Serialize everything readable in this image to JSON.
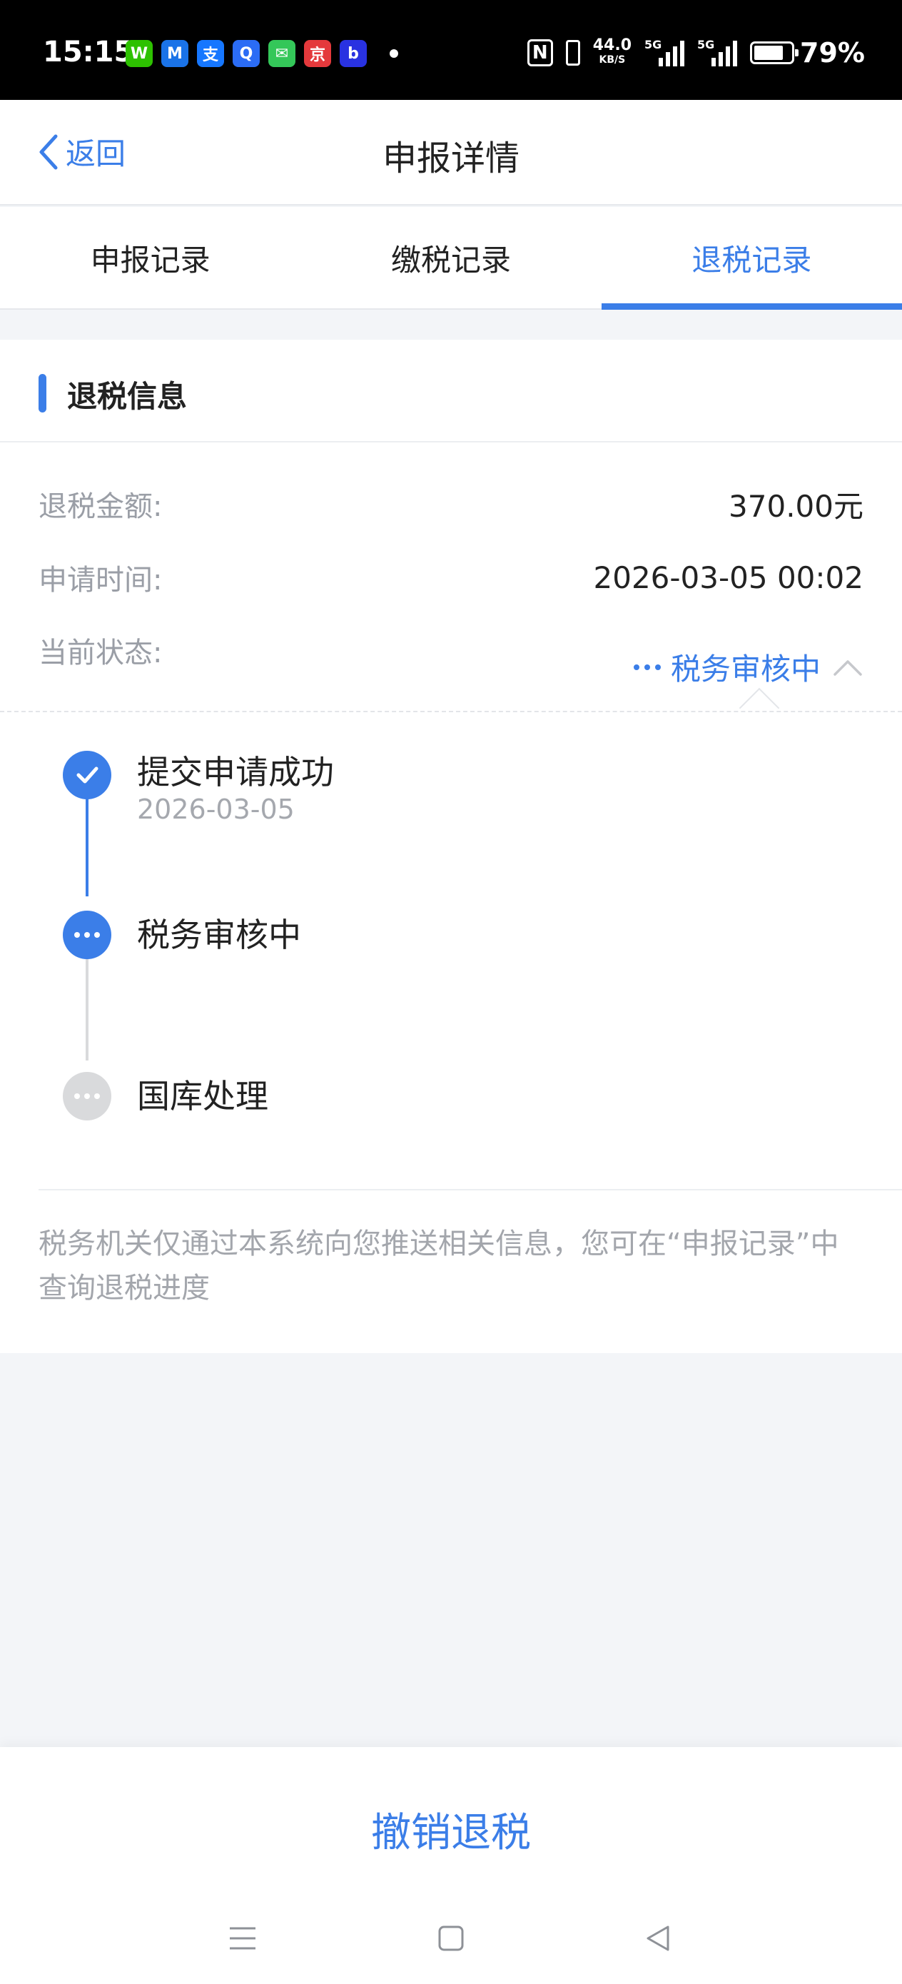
{
  "status_bar": {
    "time": "15:15",
    "apps": [
      {
        "name": "wechat-icon",
        "color": "#2dc100",
        "glyph": "W"
      },
      {
        "name": "mail-icon",
        "color": "#1a73e8",
        "glyph": "M"
      },
      {
        "name": "alipay-icon",
        "color": "#1677ff",
        "glyph": "支"
      },
      {
        "name": "qq-icon",
        "color": "#2b6cf5",
        "glyph": "Q"
      },
      {
        "name": "messages-icon",
        "color": "#34c759",
        "glyph": "✉"
      },
      {
        "name": "jd-icon",
        "color": "#e4393c",
        "glyph": "京"
      },
      {
        "name": "baidu-icon",
        "color": "#2932e1",
        "glyph": "b"
      }
    ],
    "net_speed": "44.0",
    "net_unit": "KB/S",
    "sig1_label": "5G",
    "sig2_label": "5G",
    "battery": "79%",
    "battery_level": 0.79
  },
  "header": {
    "back_label": "返回",
    "title": "申报详情"
  },
  "tabs": [
    {
      "label": "申报记录",
      "active": false
    },
    {
      "label": "缴税记录",
      "active": false
    },
    {
      "label": "退税记录",
      "active": true
    }
  ],
  "refund": {
    "section_title": "退税信息",
    "amount_label": "退税金额:",
    "amount_value": "370.00元",
    "time_label": "申请时间:",
    "time_value": "2026-03-05 00:02",
    "status_label": "当前状态:",
    "status_value": "税务审核中"
  },
  "timeline": [
    {
      "title": "提交申请成功",
      "date": "2026-03-05",
      "state": "done"
    },
    {
      "title": "税务审核中",
      "date": "",
      "state": "current"
    },
    {
      "title": "国库处理",
      "date": "",
      "state": "pending"
    }
  ],
  "notice": "税务机关仅通过本系统向您推送相关信息，您可在“申报记录”中查询退税进度",
  "actions": {
    "cancel_label": "撤销退税"
  },
  "colors": {
    "accent": "#3b7ee8",
    "pending": "#d9dadc",
    "muted_text": "#9a9ea6"
  }
}
